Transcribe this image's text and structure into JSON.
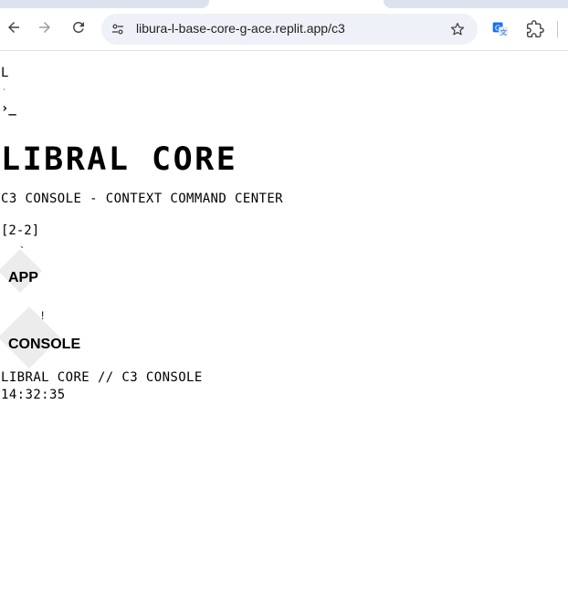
{
  "browser": {
    "url": "libura-l-base-core-g-ace.replit.app/c3",
    "icons": {
      "back": "arrow-left-icon",
      "forward": "arrow-right-icon",
      "reload": "reload-icon",
      "site_info": "tune-icon",
      "bookmark": "star-icon",
      "translate": "translate-icon",
      "extensions": "puzzle-icon"
    },
    "colors": {
      "omnibox": "#eef1f7",
      "translate_blue": "#1a73e8"
    }
  },
  "page": {
    "logo_letter": "L",
    "prompt_glyph": "›_",
    "title": "LIBRAL CORE",
    "subtitle": "C3 CONSOLE - CONTEXT COMMAND CENTER",
    "counter": "[2-2]",
    "nodes": [
      {
        "label": "APP",
        "mark": "`"
      },
      {
        "label": "CONSOLE",
        "mark": "!"
      }
    ],
    "footer": {
      "brand": "LIBRAL CORE // C3 CONSOLE",
      "time": "14:32:35"
    }
  }
}
